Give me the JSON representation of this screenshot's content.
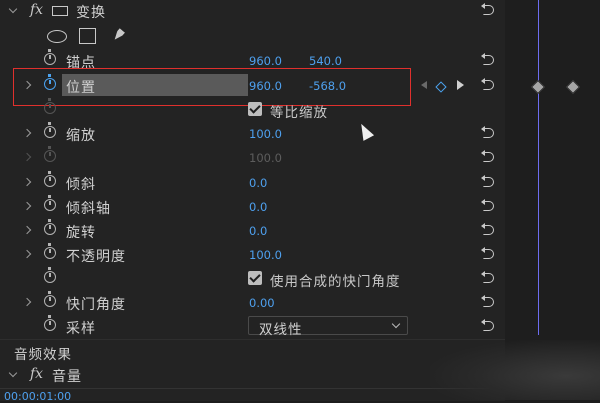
{
  "transform": {
    "header_label": "变换",
    "anchor": {
      "label": "锚点",
      "x": "960.0",
      "y": "540.0"
    },
    "position": {
      "label": "位置",
      "x": "960.0",
      "y": "-568.0"
    },
    "uniform_scale": {
      "label": "等比缩放"
    },
    "scale": {
      "label": "缩放",
      "value": "100.0"
    },
    "scale_width": {
      "value": "100.0"
    },
    "skew": {
      "label": "倾斜",
      "value": "0.0"
    },
    "skew_axis": {
      "label": "倾斜轴",
      "value": "0.0"
    },
    "rotation": {
      "label": "旋转",
      "value": "0.0"
    },
    "opacity": {
      "label": "不透明度",
      "value": "100.0"
    },
    "use_comp_shutter": {
      "label": "使用合成的快门角度"
    },
    "shutter_angle": {
      "label": "快门角度",
      "value": "0.00"
    },
    "sampling": {
      "label": "采样",
      "selected": "双线性"
    }
  },
  "audio_effects": {
    "label": "音频效果"
  },
  "volume": {
    "label": "音量"
  },
  "timecode": "00:00:01:00",
  "colors": {
    "accent_blue": "#4ea0ee",
    "highlight_red": "#e0302d"
  }
}
